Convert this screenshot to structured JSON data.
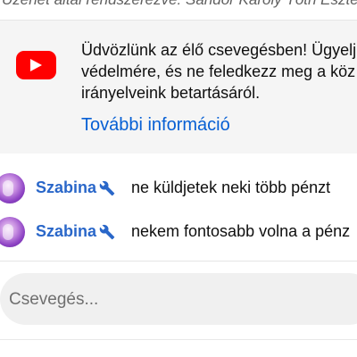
{
  "top_banner": {
    "text": "Üzenet által rendszerezve: Sándor Károly Tóth Eszter ellenőrizve"
  },
  "welcome": {
    "icon": "youtube-logo-icon",
    "text": "Üdvözlünk az élő csevegésben! Ügyelj\nvédelmére, és ne feledkezz meg a köz\nirányelveink betartásáról.",
    "link": "További információ",
    "link_color": "#065fd4"
  },
  "messages": [
    {
      "author": "Szabina",
      "badge_icon": "wrench-icon",
      "text": "ne küldjetek neki több pénzt"
    },
    {
      "author": "Szabina",
      "badge_icon": "wrench-icon",
      "text": "nekem fontosabb volna a pénz"
    }
  ],
  "chat_input": {
    "placeholder": "Csevegés..."
  },
  "colors": {
    "author": "#2a67c9",
    "youtube_red": "#ff0000",
    "welcome_bg": "#f5f5f5"
  }
}
